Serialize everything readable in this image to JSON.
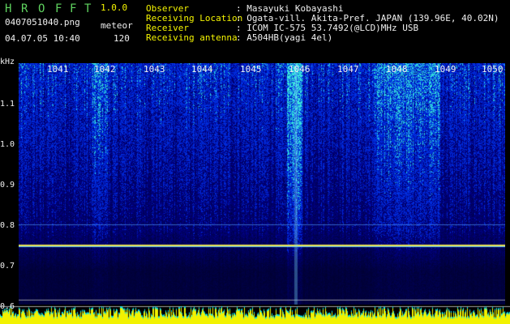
{
  "app": {
    "logo_letters": [
      "H",
      "R",
      "O",
      "F",
      "F",
      "T"
    ],
    "version": "1.0.0",
    "filename": "0407051040.png",
    "mode": "meteor",
    "datetime": "04.07.05 10:40",
    "count": "120"
  },
  "info": {
    "observer_label": "Observer",
    "observer_value": ": Masayuki Kobayashi",
    "location_label": "Receiving Location",
    "location_value": ": Ogata-vill. Akita-Pref. JAPAN (139.96E, 40.02N)",
    "receiver_label": "Receiver",
    "receiver_value": ": ICOM IC-575 53.7492(@LCD)MHz USB",
    "antenna_label": "Receiving antenna",
    "antenna_value": ": A504HB(yagi 4el)"
  },
  "axis": {
    "y_unit": "kHz",
    "y_ticks": [
      "1.1",
      "1.0",
      "0.9",
      "0.8",
      "0.7",
      "0.6"
    ],
    "x_ticks": [
      "1041",
      "1042",
      "1043",
      "1044",
      "1045",
      "1046",
      "1047",
      "1048",
      "1049",
      "1050"
    ]
  },
  "colors": {
    "header_green": "#5fd35f",
    "header_yellow": "#f5f500",
    "spectrum_bg": "#0a1450",
    "amplitude_yellow": "#f2f200",
    "amplitude_cyan": "#00e0f0"
  }
}
